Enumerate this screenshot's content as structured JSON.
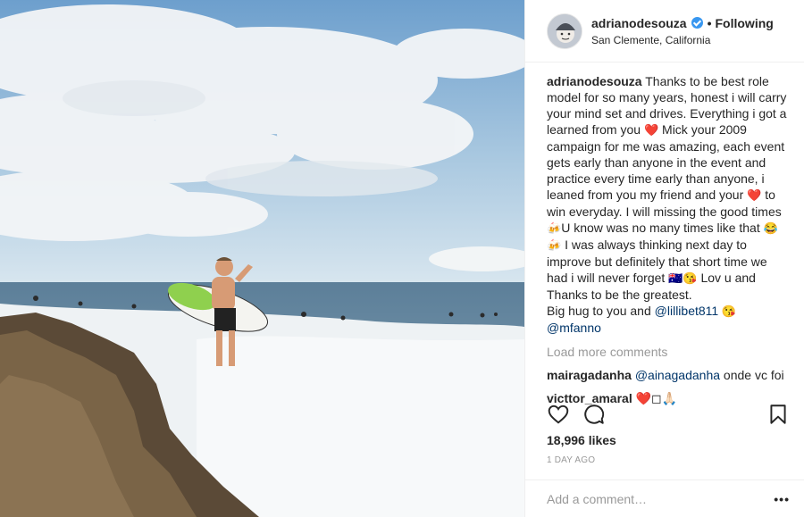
{
  "post": {
    "username": "adrianodesouza",
    "verified_icon": "verified-badge-icon",
    "separator": "•",
    "following_label": "Following",
    "location": "San Clemente, California",
    "caption": {
      "username": "adrianodesouza",
      "text_1": " Thanks to be best role model for so many years, honest i will carry your mind set and drives. Everything i got a learned from you ",
      "emoji_heart_1": "❤️",
      "text_2": " Mick your 2009 campaign for me was amazing, each event gets early than anyone in the event and practice every time early than anyone, i leaned from you my friend and your ",
      "emoji_heart_2": "❤️",
      "text_3": " to win everyday. I will missing the good times ",
      "emoji_beer_1": "🍻",
      "text_4": "U know was no many times like that ",
      "emoji_joy_beer": "😂🍻",
      "text_5": " I was always thinking next day to improve but definitely that short time we had i will never forget ",
      "emoji_flag_kiss": "🇦🇺😘",
      "text_6": " Lov u and Thanks to be the greatest.\nBig hug to you and ",
      "mention_1": "@lillibet811",
      "emoji_kiss": " 😘",
      "newline": "\n",
      "mention_2": "@mfanno"
    },
    "load_more_label": "Load more comments",
    "comments": [
      {
        "username": "mairagadanha",
        "mention": "@ainagadanha",
        "text": " onde vc foi"
      },
      {
        "username": "victtor_amaral",
        "text": "❤️◻🙏🏻"
      }
    ],
    "likes": "18,996 likes",
    "time_ago": "1 DAY AGO",
    "add_comment_placeholder": "Add a comment…",
    "more_label": "•••",
    "icons": {
      "like": "heart-icon",
      "comment": "comment-bubble-icon",
      "save": "bookmark-icon"
    },
    "colors": {
      "link": "#003569",
      "verified": "#3897f0",
      "muted": "#999999"
    }
  }
}
